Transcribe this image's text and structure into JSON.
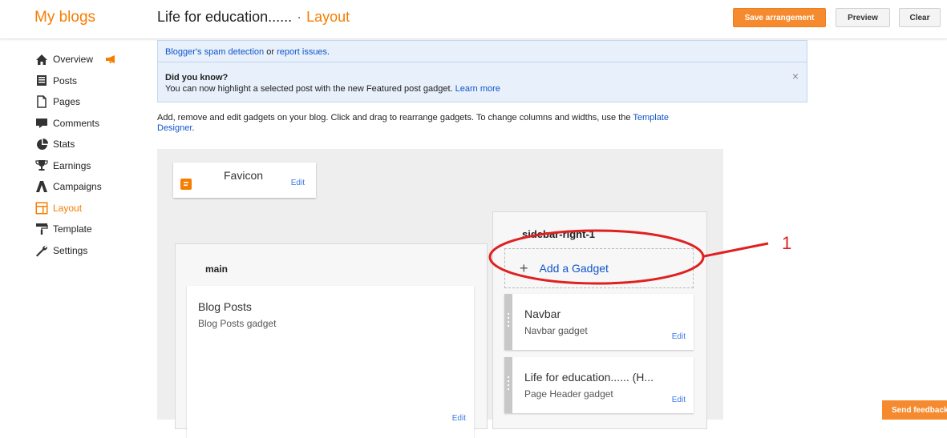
{
  "header": {
    "brand": "My blogs",
    "blog_title": "Life for education......",
    "separator": "·",
    "page": "Layout",
    "save_label": "Save arrangement",
    "preview_label": "Preview",
    "clear_label": "Clear"
  },
  "nav": {
    "items": [
      {
        "label": "Overview",
        "icon": "home-icon"
      },
      {
        "label": "Posts",
        "icon": "posts-icon"
      },
      {
        "label": "Pages",
        "icon": "pages-icon"
      },
      {
        "label": "Comments",
        "icon": "comment-icon"
      },
      {
        "label": "Stats",
        "icon": "pie-chart-icon"
      },
      {
        "label": "Earnings",
        "icon": "trophy-icon"
      },
      {
        "label": "Campaigns",
        "icon": "campaign-icon"
      },
      {
        "label": "Layout",
        "icon": "layout-icon"
      },
      {
        "label": "Template",
        "icon": "paint-roller-icon"
      },
      {
        "label": "Settings",
        "icon": "wrench-icon"
      }
    ],
    "active": "Layout",
    "accent": "#f57d00"
  },
  "info": {
    "spam_link": "Blogger's spam detection",
    "or_text": " or ",
    "report_link": "report issues.",
    "dyk_title": "Did you know?",
    "dyk_text": "You can now highlight a selected post with the new Featured post gadget.",
    "learn_more": "Learn more",
    "close": "×"
  },
  "instructions": {
    "text": "Add, remove and edit gadgets on your blog. Click and drag to rearrange gadgets. To change columns and widths, use the",
    "link": "Template Designer",
    "end": "."
  },
  "favicon": {
    "title": "Favicon",
    "edit": "Edit",
    "logo_letter": "B"
  },
  "main": {
    "title": "main",
    "gadget_title": "Blog Posts",
    "gadget_sub": "Blog Posts gadget",
    "edit": "Edit"
  },
  "sidebar_right": {
    "title": "sidebar-right-1",
    "add_plus": "+",
    "add_label": "Add a Gadget",
    "gadgets": [
      {
        "title": "Navbar",
        "sub": "Navbar gadget",
        "edit": "Edit"
      },
      {
        "title": "Life for education...... (H...",
        "sub": "Page Header gadget",
        "edit": "Edit"
      }
    ]
  },
  "annotation": {
    "label": "1",
    "color": "#e02020"
  },
  "feedback": {
    "label": "Send feedback"
  }
}
